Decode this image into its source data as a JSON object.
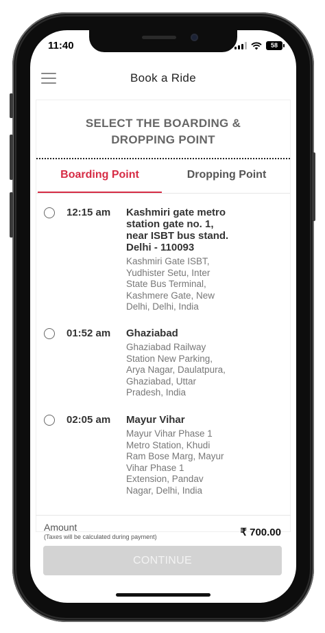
{
  "status_bar": {
    "time": "11:40",
    "battery": "58"
  },
  "app_bar": {
    "title": "Book a Ride"
  },
  "heading": {
    "line1": "SELECT THE BOARDING &",
    "line2": "DROPPING POINT"
  },
  "tabs": [
    {
      "label": "Boarding Point",
      "active": true
    },
    {
      "label": "Dropping Point",
      "active": false
    }
  ],
  "stops": [
    {
      "time": "12:15 am",
      "name_lines": [
        "Kashmiri gate metro",
        "station gate no. 1,",
        "near ISBT bus stand.",
        "Delhi - 110093"
      ],
      "address_lines": [
        "Kashmiri Gate ISBT,",
        "Yudhister Setu, Inter",
        "State Bus Terminal,",
        "Kashmere Gate, New",
        "Delhi, Delhi, India"
      ]
    },
    {
      "time": "01:52 am",
      "name_lines": [
        "Ghaziabad"
      ],
      "address_lines": [
        "Ghaziabad Railway",
        "Station New Parking,",
        "Arya Nagar, Daulatpura,",
        "Ghaziabad, Uttar",
        "Pradesh, India"
      ]
    },
    {
      "time": "02:05 am",
      "name_lines": [
        "Mayur Vihar"
      ],
      "address_lines": [
        "Mayur Vihar Phase 1",
        "Metro Station, Khudi",
        "Ram Bose Marg, Mayur",
        "Vihar Phase 1",
        "Extension, Pandav",
        "Nagar, Delhi, India"
      ]
    }
  ],
  "footer": {
    "amount_label": "Amount",
    "tax_note": "(Taxes will be calculated during payment)",
    "amount_value": "₹ 700.00",
    "continue_label": "CONTINUE"
  },
  "colors": {
    "accent": "#d62b44",
    "button_disabled": "#d3d3d3"
  },
  "icons": {
    "menu": "hamburger-menu-icon",
    "radio": "radio-unselected-icon"
  }
}
